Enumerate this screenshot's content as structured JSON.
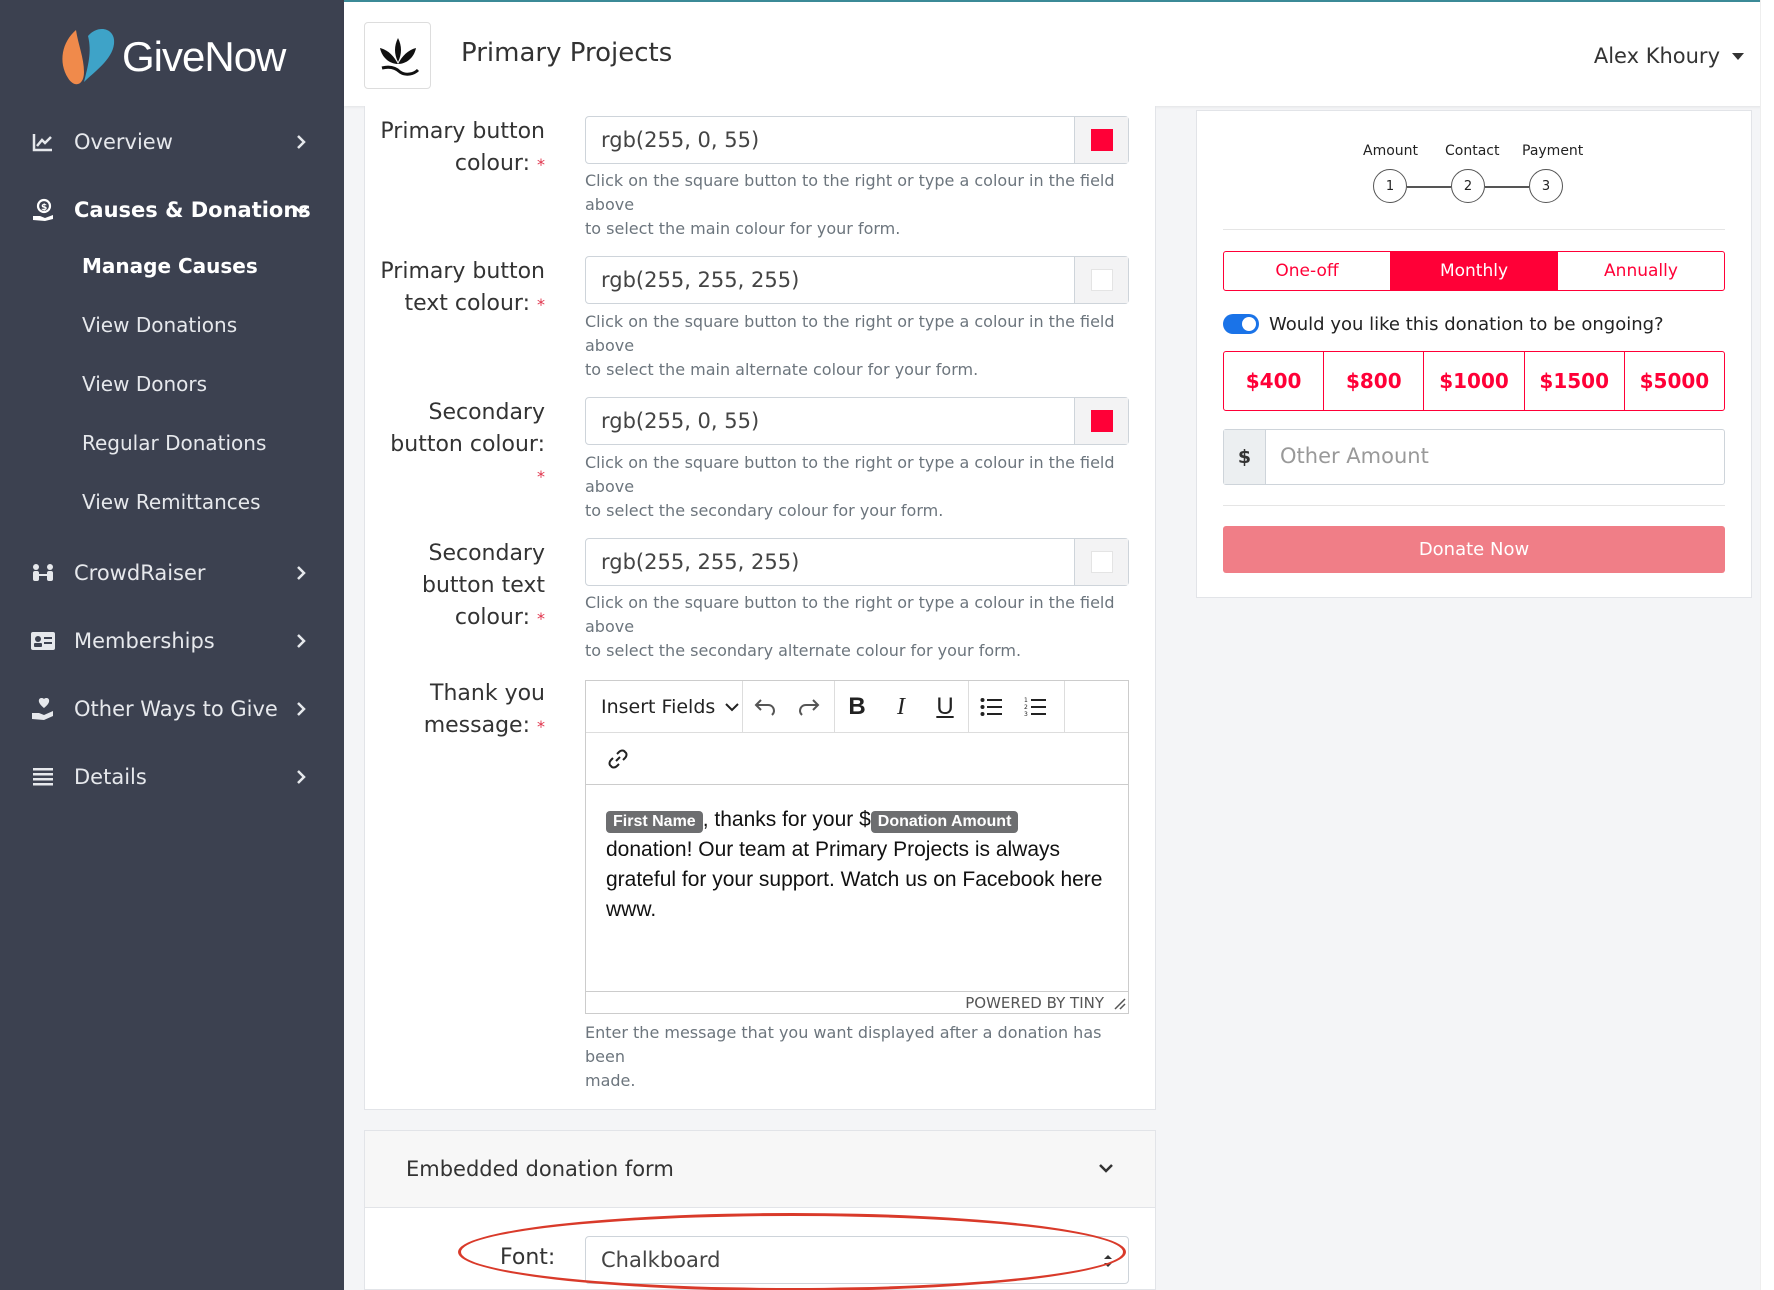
{
  "sidebar": {
    "logo_text": "GiveNow",
    "items": [
      {
        "label": "Overview",
        "icon": "chart-line-icon"
      },
      {
        "label": "Causes & Donations",
        "icon": "hand-coin-icon"
      },
      {
        "label": "CrowdRaiser",
        "icon": "people-icon"
      },
      {
        "label": "Memberships",
        "icon": "id-card-icon"
      },
      {
        "label": "Other Ways to Give",
        "icon": "hand-heart-icon"
      },
      {
        "label": "Details",
        "icon": "list-icon"
      }
    ],
    "subitems": [
      "Manage Causes",
      "View Donations",
      "View Donors",
      "Regular Donations",
      "View Remittances"
    ]
  },
  "header": {
    "title": "Primary Projects",
    "user": "Alex Khoury"
  },
  "form": {
    "primary_button_colour": {
      "label_line1": "Primary button",
      "label_line2": "colour:",
      "value": "rgb(255, 0, 55)",
      "swatch": "#ff0037",
      "help_line1": "Click on the square button to the right or type a colour in the field above",
      "help_line2": "to select the main colour for your form."
    },
    "primary_button_text_colour": {
      "label_line1": "Primary button",
      "label_line2": "text colour:",
      "value": "rgb(255, 255, 255)",
      "swatch": "#ffffff",
      "help_line1": "Click on the square button to the right or type a colour in the field above",
      "help_line2": "to select the main alternate colour for your form."
    },
    "secondary_button_colour": {
      "label_line1": "Secondary",
      "label_line2": "button colour:",
      "value": "rgb(255, 0, 55)",
      "swatch": "#ff0037",
      "help_line1": "Click on the square button to the right or type a colour in the field above",
      "help_line2": "to select the secondary colour for your form."
    },
    "secondary_button_text_colour": {
      "label_line1": "Secondary",
      "label_line2": "button text",
      "label_line3": "colour:",
      "value": "rgb(255, 255, 255)",
      "swatch": "#ffffff",
      "help_line1": "Click on the square button to the right or type a colour in the field above",
      "help_line2": "to select the secondary alternate colour for your form."
    },
    "required_mark": "*",
    "thank_you": {
      "label_line1": "Thank you",
      "label_line2": "message:",
      "insert_fields": "Insert Fields",
      "tag_first_name": "First Name",
      "text1": ", thanks for your $",
      "tag_donation_amount": "Donation Amount",
      "text2": "donation! Our team at Primary Projects is always grateful for your support. Watch us on Facebook here www.",
      "powered_by": "POWERED BY TINY",
      "help_line1": "Enter the message that you want displayed after a donation has been",
      "help_line2": "made."
    }
  },
  "embedded": {
    "title": "Embedded donation form",
    "font_label": "Font:",
    "font_value": "Chalkboard"
  },
  "preview": {
    "steps": [
      "Amount",
      "Contact",
      "Payment"
    ],
    "step_numbers": [
      "1",
      "2",
      "3"
    ],
    "frequencies": [
      "One-off",
      "Monthly",
      "Annually"
    ],
    "active_frequency": "Monthly",
    "ongoing_label": "Would you like this donation to be ongoing?",
    "ongoing_checked": true,
    "amounts": [
      "$400",
      "$800",
      "$1000",
      "$1500",
      "$5000"
    ],
    "currency_symbol": "$",
    "other_placeholder": "Other Amount",
    "donate_label": "Donate Now",
    "accent_color": "#ff0037"
  }
}
